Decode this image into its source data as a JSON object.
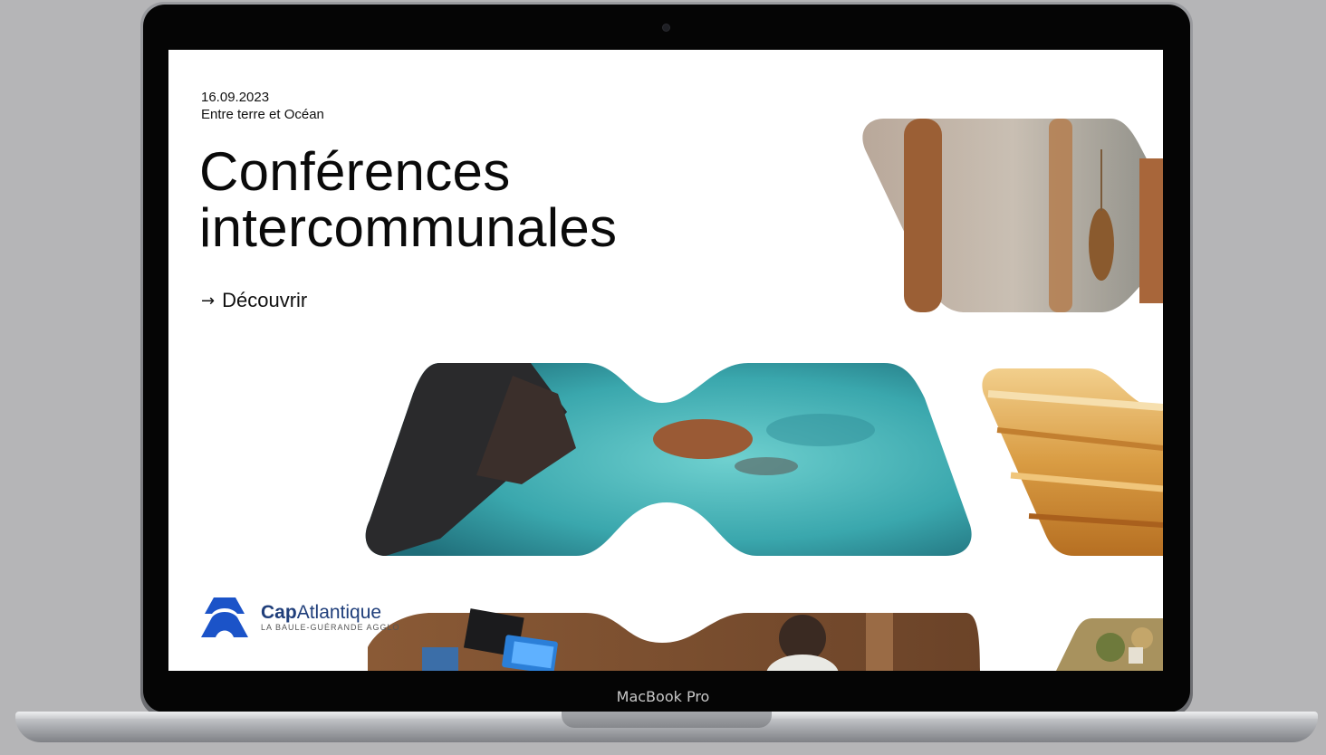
{
  "device": {
    "label": "MacBook Pro"
  },
  "hero": {
    "date": "16.09.2023",
    "subtitle": "Entre terre et Océan",
    "title_line1": "Conférences",
    "title_line2": "intercommunales",
    "cta_arrow": "→",
    "cta_label": "Découvrir"
  },
  "logo": {
    "name_bold": "Cap",
    "name_regular": "Atlantique",
    "tagline": "LA BAULE-GUÉRANDE AGGLO"
  },
  "colors": {
    "brand_blue": "#1b53c8",
    "text": "#111111",
    "background": "#ffffff"
  },
  "images": {
    "reeds": "reeds-photo",
    "coast": "rocky-coast-photo",
    "crepes": "crepes-photo",
    "workspace": "workspace-photo",
    "landscape": "landscape-photo"
  }
}
